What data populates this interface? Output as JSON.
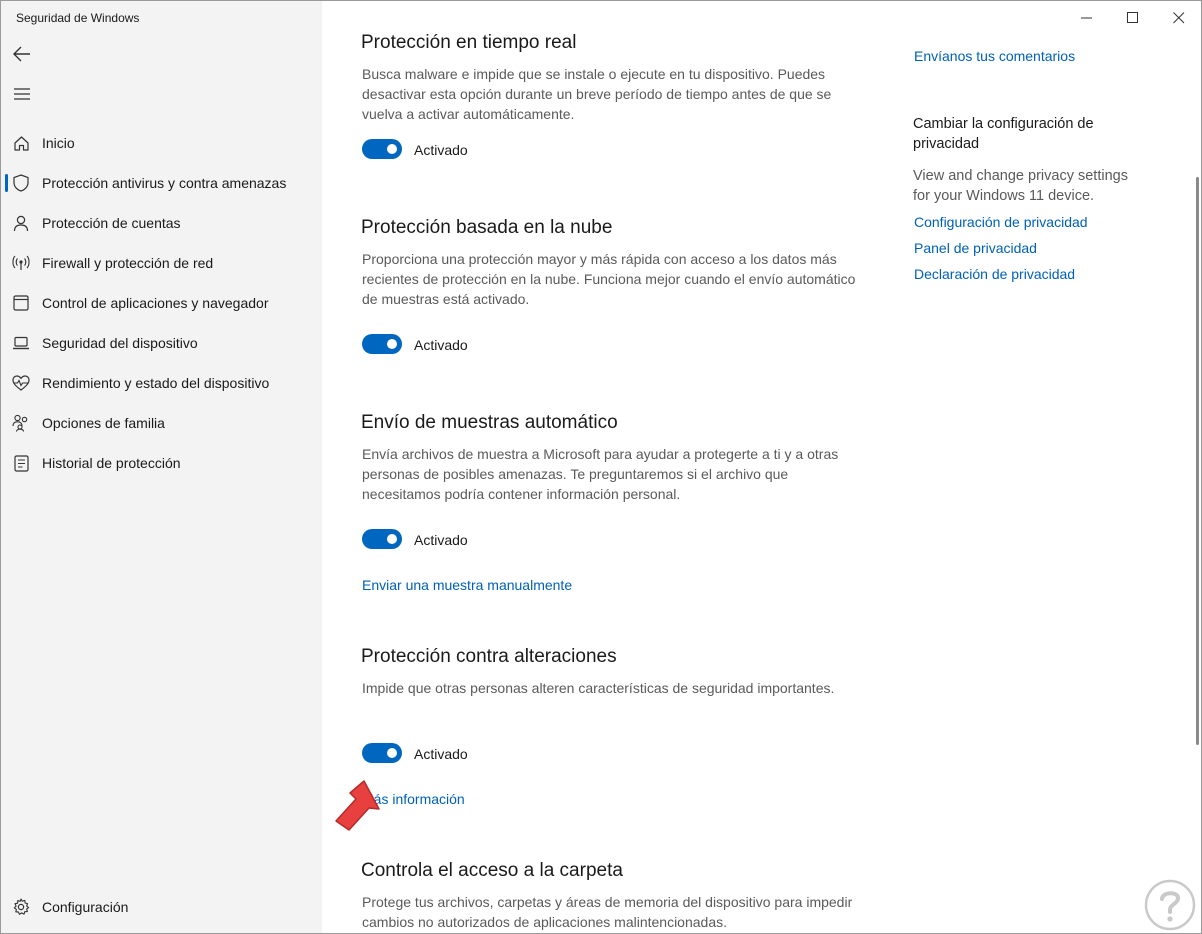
{
  "window": {
    "title": "Seguridad de Windows",
    "controls": [
      "minimize-icon",
      "maximize-icon",
      "close-icon"
    ]
  },
  "sidebar": {
    "items": [
      {
        "label": "Inicio",
        "icon": "home-icon"
      },
      {
        "label": "Protección antivirus y contra amenazas",
        "icon": "shield-icon",
        "active": true
      },
      {
        "label": "Protección de cuentas",
        "icon": "person-icon"
      },
      {
        "label": "Firewall y protección de red",
        "icon": "antenna-icon"
      },
      {
        "label": "Control de aplicaciones y navegador",
        "icon": "app-browser-icon"
      },
      {
        "label": "Seguridad del dispositivo",
        "icon": "laptop-icon"
      },
      {
        "label": "Rendimiento y estado del dispositivo",
        "icon": "heart-pulse-icon"
      },
      {
        "label": "Opciones de familia",
        "icon": "family-icon"
      },
      {
        "label": "Historial de protección",
        "icon": "history-icon"
      }
    ],
    "settings_label": "Configuración"
  },
  "main": {
    "sections": [
      {
        "title": "Protección en tiempo real",
        "description": "Busca malware e impide que se instale o ejecute en tu dispositivo. Puedes desactivar esta opción durante un breve período de tiempo antes de que se vuelva a activar automáticamente.",
        "toggle_state": "Activado"
      },
      {
        "title": "Protección basada en la nube",
        "description": "Proporciona una protección mayor y más rápida con acceso a los datos más recientes de protección en la nube. Funciona mejor cuando el envío automático de muestras está activado.",
        "toggle_state": "Activado"
      },
      {
        "title": "Envío de muestras automático",
        "description": "Envía archivos de muestra a Microsoft para ayudar a protegerte a ti y a otras personas de posibles amenazas. Te preguntaremos si el archivo que necesitamos podría contener información personal.",
        "toggle_state": "Activado",
        "link": "Enviar una muestra manualmente"
      },
      {
        "title": "Protección contra alteraciones",
        "description": "Impide que otras personas alteren características de seguridad importantes.",
        "toggle_state": "Activado",
        "link": "Más información"
      },
      {
        "title": "Controla el acceso a la carpeta",
        "description": "Protege tus archivos, carpetas y áreas de memoria del dispositivo para impedir cambios no autorizados de aplicaciones malintencionadas."
      }
    ]
  },
  "right_panel": {
    "feedback_link": "Envíanos tus comentarios",
    "privacy_heading": "Cambiar la configuración de privacidad",
    "privacy_text": "View and change privacy settings for your Windows 11 device.",
    "links": [
      "Configuración de privacidad",
      "Panel de privacidad",
      "Declaración de privacidad"
    ]
  },
  "colors": {
    "accent": "#0067c0",
    "sidebar_bg": "#f3f3f3",
    "annotation_arrow": "#e8403f"
  }
}
